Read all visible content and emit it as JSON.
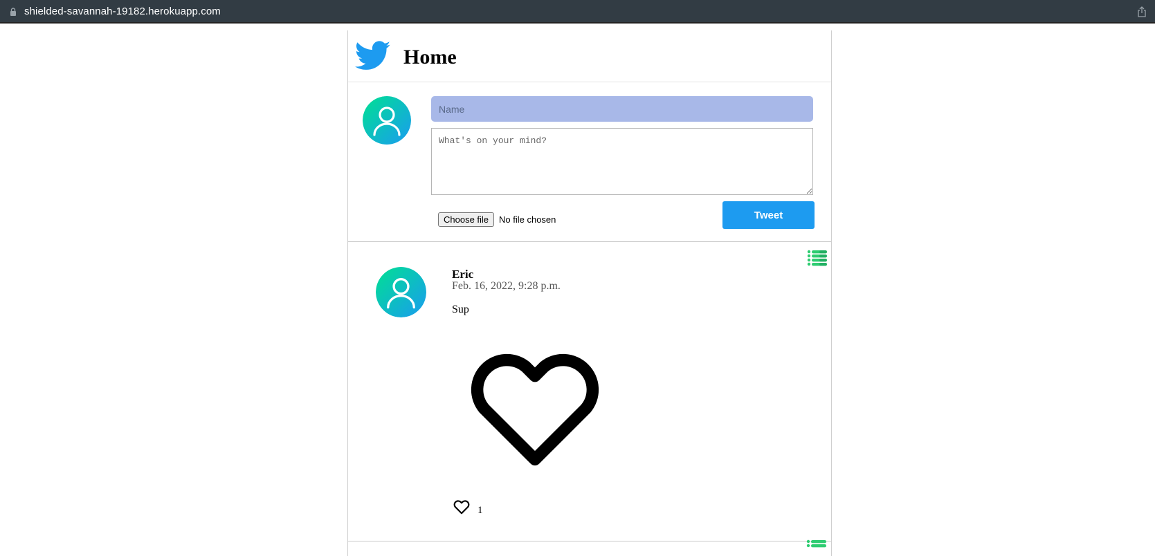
{
  "browser": {
    "url": "shielded-savannah-19182.herokuapp.com"
  },
  "header": {
    "title": "Home"
  },
  "composer": {
    "name_placeholder": "Name",
    "message_placeholder": "What's on your mind?",
    "file_button_label": "Choose file",
    "file_status": "No file chosen",
    "submit_label": "Tweet"
  },
  "posts": [
    {
      "author": "Eric",
      "date": "Feb. 16, 2022, 9:28 p.m.",
      "text": "Sup",
      "likes": "1"
    }
  ],
  "colors": {
    "brand": "#1d9bf0",
    "topbar": "#323c44",
    "name_field": "#a8b8e8",
    "menu_icon": "#2ecc71"
  }
}
